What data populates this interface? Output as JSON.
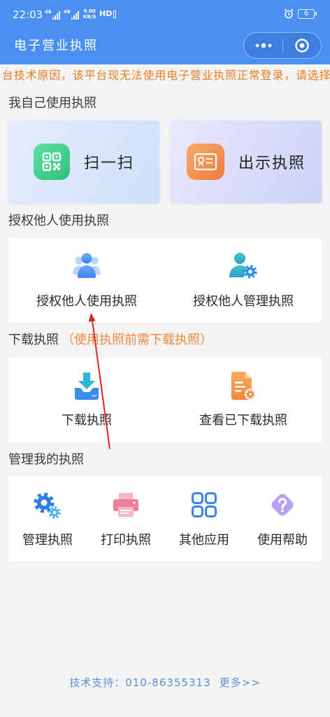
{
  "status_bar": {
    "time": "22:03",
    "network_1": "46",
    "network_2": "46",
    "speed_value": "9.00",
    "speed_unit": "KB/S",
    "hd": "HD",
    "battery_level": "6",
    "alarm_icon": "alarm-clock-icon"
  },
  "header": {
    "title": "电子营业执照",
    "more_icon": "more-dots-icon",
    "exit_icon": "target-circle-icon"
  },
  "notice": {
    "text": "台技术原因，该平台现无法使用电子营业执照正常登录，请选择"
  },
  "self_use": {
    "title": "我自己使用执照",
    "items": [
      {
        "label": "扫一扫",
        "icon": "qr-code-icon"
      },
      {
        "label": "出示执照",
        "icon": "license-card-icon"
      }
    ]
  },
  "authorize": {
    "title": "授权他人使用执照",
    "items": [
      {
        "label": "授权他人使用执照",
        "icon": "user-group-icon"
      },
      {
        "label": "授权他人管理执照",
        "icon": "user-gear-icon"
      }
    ]
  },
  "download": {
    "title": "下载执照",
    "hint": "（使用执照前需下载执照）",
    "items": [
      {
        "label": "下载执照",
        "icon": "download-icon"
      },
      {
        "label": "查看已下载执照",
        "icon": "document-gear-icon"
      }
    ]
  },
  "manage": {
    "title": "管理我的执照",
    "items": [
      {
        "label": "管理执照",
        "icon": "gears-icon"
      },
      {
        "label": "打印执照",
        "icon": "printer-icon"
      },
      {
        "label": "其他应用",
        "icon": "apps-grid-icon"
      },
      {
        "label": "使用帮助",
        "icon": "help-icon"
      }
    ]
  },
  "footer": {
    "support_label": "技术支持：",
    "phone": "010-86355313",
    "more": "更多>>"
  },
  "colors": {
    "brand_blue": "#4a8ff2",
    "notice_orange": "#ee7c1e",
    "hint_orange": "#f0883a",
    "footer_blue": "#5b8fd8",
    "annotation_red": "#e02424"
  }
}
